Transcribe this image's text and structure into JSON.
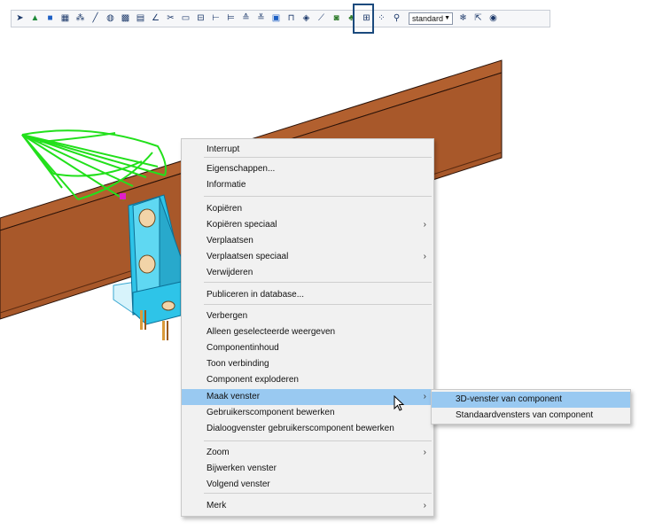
{
  "toolbar": {
    "icons": [
      "pointer-icon",
      "green-triangle-icon",
      "blue-square-icon",
      "grid-pattern-icon",
      "dots-icon",
      "line-icon",
      "sphere-icon",
      "grid-icon",
      "dashed-grid-icon",
      "angle-icon",
      "scissors-icon",
      "box-icon",
      "split-icon",
      "align-icon",
      "measure-icon",
      "dimension-icon",
      "dimension-alt-icon",
      "component-icon",
      "frame-icon",
      "layers-icon",
      "tilt-icon",
      "view-component-icon",
      "tree-icon",
      "grid-select-icon",
      "group-icon",
      "search-icon"
    ],
    "select_value": "standard",
    "trailing_icons": [
      "snowflake-icon",
      "cursor-select-icon",
      "eye-icon"
    ],
    "active_icon": "view-component-icon"
  },
  "menu": {
    "items": [
      {
        "label": "Interrupt",
        "arrow": ""
      },
      {
        "label": "Eigenschappen...",
        "arrow": ""
      },
      {
        "label": "Informatie",
        "arrow": ""
      },
      {
        "label": "Kopiëren",
        "arrow": ""
      },
      {
        "label": "Kopiëren speciaal",
        "arrow": "›"
      },
      {
        "label": "Verplaatsen",
        "arrow": ""
      },
      {
        "label": "Verplaatsen speciaal",
        "arrow": "›"
      },
      {
        "label": "Verwijderen",
        "arrow": ""
      },
      {
        "label": "Publiceren in database...",
        "arrow": ""
      },
      {
        "label": "Verbergen",
        "arrow": ""
      },
      {
        "label": "Alleen geselecteerde weergeven",
        "arrow": ""
      },
      {
        "label": "Componentinhoud",
        "arrow": ""
      },
      {
        "label": "Toon verbinding",
        "arrow": ""
      },
      {
        "label": "Component exploderen",
        "arrow": ""
      },
      {
        "label": "Maak venster",
        "arrow": "›"
      },
      {
        "label": "Gebruikerscomponent bewerken",
        "arrow": ""
      },
      {
        "label": "Dialoogvenster gebruikerscomponent bewerken",
        "arrow": ""
      },
      {
        "label": "Zoom",
        "arrow": "›"
      },
      {
        "label": "Bijwerken venster",
        "arrow": ""
      },
      {
        "label": "Volgend venster",
        "arrow": ""
      },
      {
        "label": "Merk",
        "arrow": "›"
      }
    ],
    "highlighted": "Maak venster"
  },
  "submenu": {
    "items": [
      {
        "label": "3D-venster van component"
      },
      {
        "label": "Standaardvensters van component"
      }
    ],
    "highlighted": "3D-venster van component"
  },
  "colors": {
    "beam": "#a8582a",
    "beam_dark": "#7a3d1a",
    "cone": "#22e01b",
    "plate": "#2ec4e8",
    "bolt": "#e8b87a",
    "highlight": "#99c9f1",
    "accent": "#1b4a7d"
  }
}
